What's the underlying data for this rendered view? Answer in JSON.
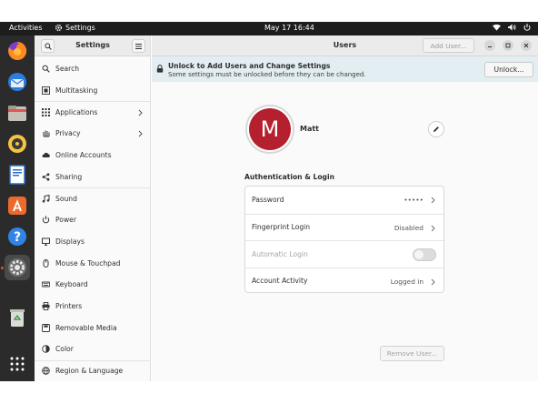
{
  "topbar": {
    "activities": "Activities",
    "app_name": "Settings",
    "clock": "May 17  16:44"
  },
  "dock": {
    "items": [
      "firefox-icon",
      "thunderbird-icon",
      "files-icon",
      "rhythmbox-icon",
      "writer-icon",
      "app-center-icon",
      "help-icon",
      "settings-icon",
      "trash-icon",
      "show-apps-icon"
    ]
  },
  "sidebar": {
    "title": "Settings",
    "items": [
      {
        "label": "Search",
        "icon": "search-icon"
      },
      {
        "label": "Multitasking",
        "icon": "multitasking-icon"
      },
      {
        "label": "Applications",
        "icon": "applications-icon",
        "chevron": true
      },
      {
        "label": "Privacy",
        "icon": "hand-icon",
        "chevron": true
      },
      {
        "label": "Online Accounts",
        "icon": "cloud-icon"
      },
      {
        "label": "Sharing",
        "icon": "share-icon"
      },
      {
        "label": "Sound",
        "icon": "music-note-icon"
      },
      {
        "label": "Power",
        "icon": "power-icon"
      },
      {
        "label": "Displays",
        "icon": "display-icon"
      },
      {
        "label": "Mouse & Touchpad",
        "icon": "mouse-icon"
      },
      {
        "label": "Keyboard",
        "icon": "keyboard-icon"
      },
      {
        "label": "Printers",
        "icon": "printer-icon"
      },
      {
        "label": "Removable Media",
        "icon": "media-icon"
      },
      {
        "label": "Color",
        "icon": "color-icon"
      },
      {
        "label": "Region & Language",
        "icon": "globe-icon"
      }
    ]
  },
  "main": {
    "title": "Users",
    "add_user": "Add User...",
    "banner": {
      "title": "Unlock to Add Users and Change Settings",
      "subtitle": "Some settings must be unlocked before they can be changed.",
      "button": "Unlock..."
    },
    "user": {
      "initial": "M",
      "name": "Matt",
      "avatar_color": "#b5202e"
    },
    "section_title": "Authentication & Login",
    "rows": [
      {
        "label": "Password",
        "value": "•••••",
        "enabled": true
      },
      {
        "label": "Fingerprint Login",
        "value": "Disabled",
        "enabled": true
      },
      {
        "label": "Automatic Login",
        "toggle": false,
        "enabled": false
      },
      {
        "label": "Account Activity",
        "value": "Logged in",
        "enabled": true
      }
    ],
    "remove_user": "Remove User..."
  }
}
